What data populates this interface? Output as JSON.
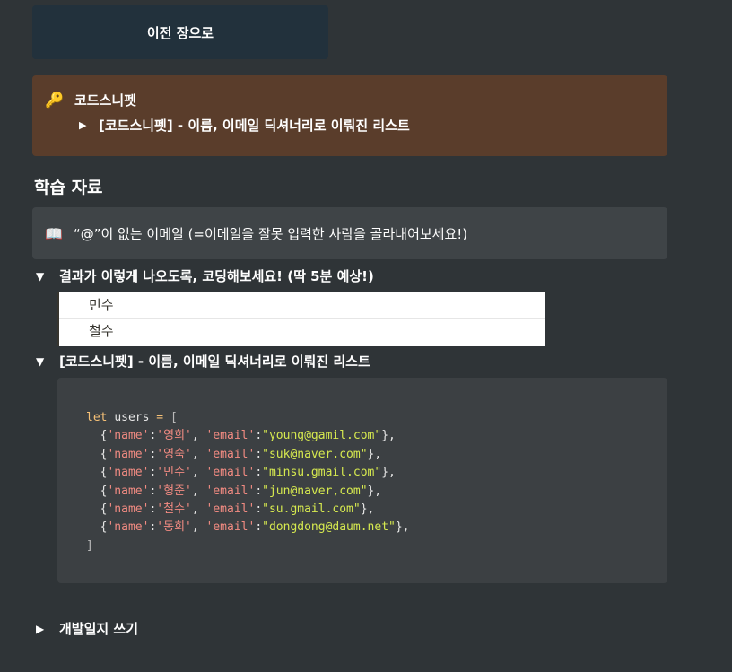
{
  "prev_button": {
    "label": "이전 장으로"
  },
  "snippet_callout": {
    "icon": "key-icon",
    "title": "코드스니펫",
    "toggle_label": "[코드스니펫] - 이름, 이메일 딕셔너리로 이뤄진 리스트"
  },
  "heading": "학습 자료",
  "book_callout": {
    "icon": "open-book-icon",
    "text": "“@”이 없는 이메일 (=이메일을 잘못 입력한 사람을 골라내어보세요!)"
  },
  "toggle_result": {
    "label": "결과가 이렇게 나오도록, 코딩해보세요! (딱 5분 예상!)"
  },
  "result_rows": [
    "민수",
    "철수"
  ],
  "toggle_snippet": {
    "label": "[코드스니펫] - 이름, 이메일 딕셔너리로 이뤄진 리스트"
  },
  "code": {
    "keyword": "let",
    "var": "users",
    "op": "=",
    "open": "[",
    "close": "]",
    "users": [
      {
        "name": "영희",
        "email": "young@gamil.com"
      },
      {
        "name": "영숙",
        "email": "suk@naver.com"
      },
      {
        "name": "민수",
        "email": "minsu.gmail.com"
      },
      {
        "name": "형준",
        "email": "jun@naver,com"
      },
      {
        "name": "철수",
        "email": "su.gmail.com"
      },
      {
        "name": "동희",
        "email": "dongdong@daum.net"
      }
    ]
  },
  "toggle_devlog": {
    "label": "개발일지 쓰기"
  },
  "colors": {
    "background": "#2f3437",
    "prev_button_bg": "#22313c",
    "snippet_callout_bg": "#5a3d2b",
    "book_callout_bg": "#3f4447",
    "code_bg": "#3c4043"
  }
}
